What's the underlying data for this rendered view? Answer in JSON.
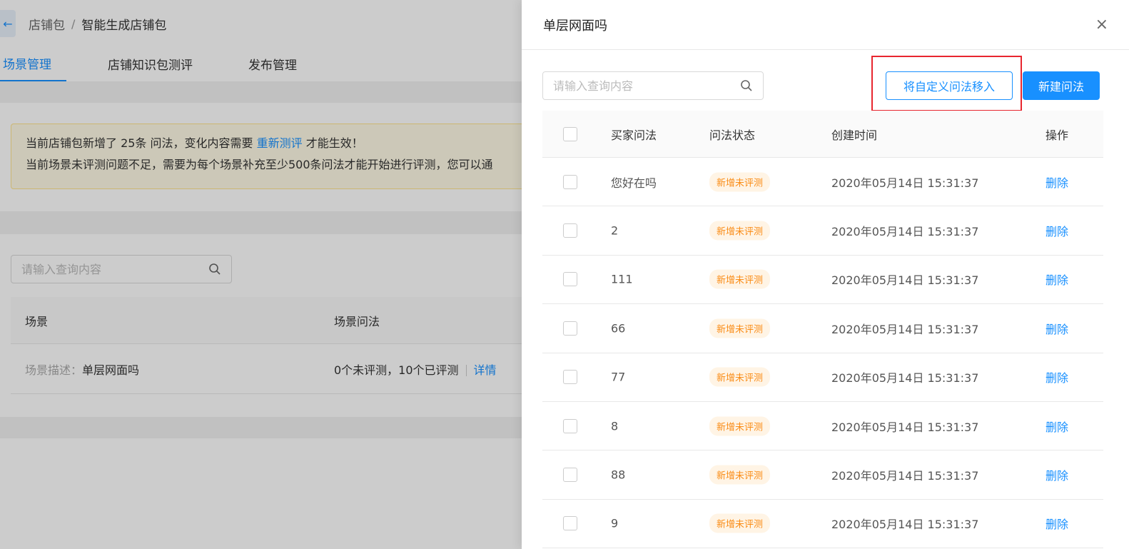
{
  "background": {
    "breadcrumb": {
      "back_icon": "←",
      "parent": "店铺包",
      "separator": "/",
      "current": "智能生成店铺包"
    },
    "tabs": [
      {
        "label": "场景管理",
        "active": true
      },
      {
        "label": "店铺知识包测评",
        "active": false
      },
      {
        "label": "发布管理",
        "active": false
      }
    ],
    "alert": {
      "line1_prefix": "当前店铺包新增了 25条 问法，变化内容需要 ",
      "line1_link": "重新测评",
      "line1_suffix": " 才能生效！",
      "line2": "当前场景未评测问题不足，需要为每个场景补充至少500条问法才能开始进行评测，您可以通"
    },
    "search": {
      "placeholder": "请输入查询内容"
    },
    "table": {
      "headers": [
        "场景",
        "场景问法"
      ],
      "row": {
        "desc_label": "场景描述：",
        "desc_value": "单层网面吗",
        "counts": "0个未评测，10个已评测",
        "detail_link": "详情"
      }
    }
  },
  "drawer": {
    "title": "单层网面吗",
    "close_icon": "×",
    "search": {
      "placeholder": "请输入查询内容"
    },
    "buttons": {
      "move_in": "将自定义问法移入",
      "new_question": "新建问法"
    },
    "table": {
      "headers": {
        "question": "买家问法",
        "status": "问法状态",
        "created": "创建时间",
        "action": "操作"
      },
      "rows": [
        {
          "question": "您好在吗",
          "status": "新增未评测",
          "created": "2020年05月14日 15:31:37",
          "action": "删除"
        },
        {
          "question": "2",
          "status": "新增未评测",
          "created": "2020年05月14日 15:31:37",
          "action": "删除"
        },
        {
          "question": "111",
          "status": "新增未评测",
          "created": "2020年05月14日 15:31:37",
          "action": "删除"
        },
        {
          "question": "66",
          "status": "新增未评测",
          "created": "2020年05月14日 15:31:37",
          "action": "删除"
        },
        {
          "question": "77",
          "status": "新增未评测",
          "created": "2020年05月14日 15:31:37",
          "action": "删除"
        },
        {
          "question": "8",
          "status": "新增未评测",
          "created": "2020年05月14日 15:31:37",
          "action": "删除"
        },
        {
          "question": "88",
          "status": "新增未评测",
          "created": "2020年05月14日 15:31:37",
          "action": "删除"
        },
        {
          "question": "9",
          "status": "新增未评测",
          "created": "2020年05月14日 15:31:37",
          "action": "删除"
        }
      ]
    }
  },
  "colors": {
    "primary": "#1890ff",
    "highlight": "#e8262f",
    "tag_text": "#fa8c16",
    "tag_bg": "#fff4e5"
  }
}
